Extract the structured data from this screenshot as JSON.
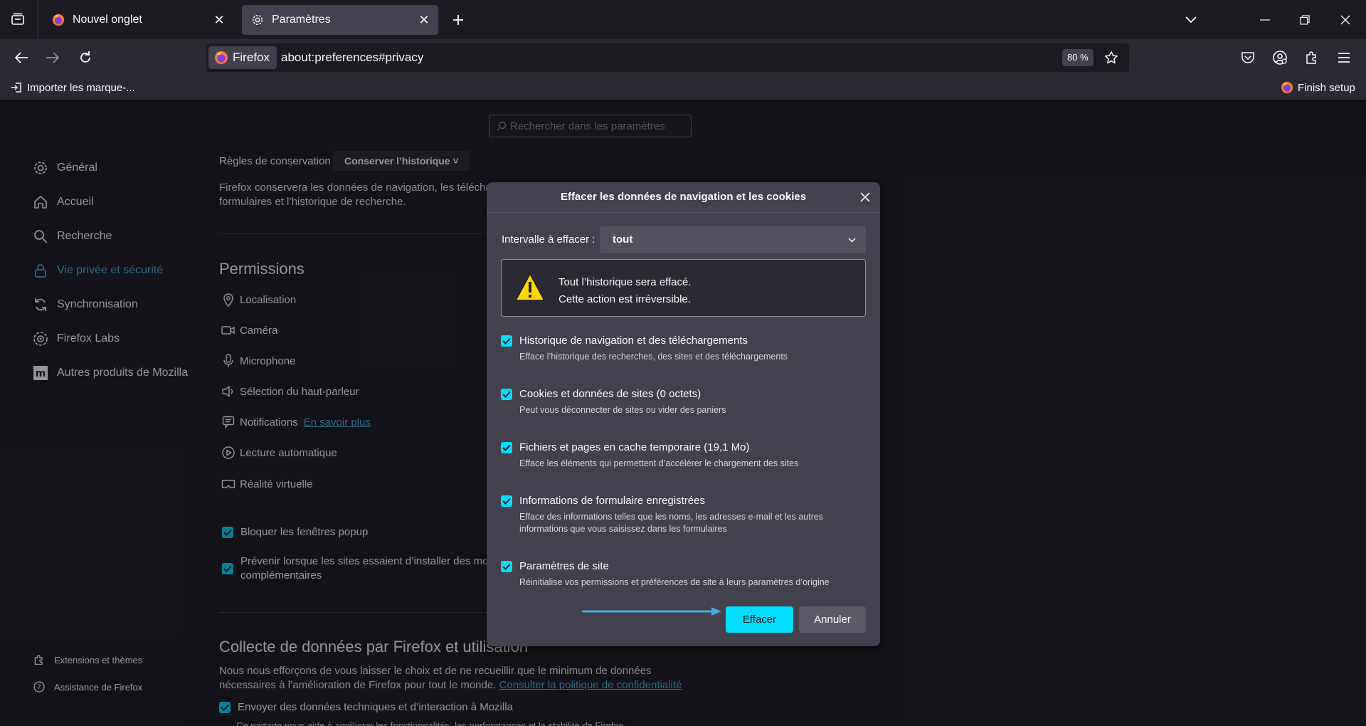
{
  "tabs": [
    {
      "title": "Nouvel onglet",
      "icon": "firefox-icon"
    },
    {
      "title": "Paramètres",
      "icon": "gear-icon",
      "active": true
    }
  ],
  "urlbar": {
    "identity_label": "Firefox",
    "url": "about:preferences#privacy",
    "zoom": "80 %"
  },
  "bookmarks": {
    "import_label": "Importer les marque-...",
    "finish_setup_label": "Finish setup"
  },
  "settings": {
    "search_placeholder": "Rechercher dans les paramètres",
    "sidebar": [
      {
        "label": "Général",
        "icon": "gear-icon"
      },
      {
        "label": "Accueil",
        "icon": "home-icon"
      },
      {
        "label": "Recherche",
        "icon": "search-icon"
      },
      {
        "label": "Vie privée et sécurité",
        "icon": "lock-icon",
        "active": true
      },
      {
        "label": "Synchronisation",
        "icon": "sync-icon"
      },
      {
        "label": "Firefox Labs",
        "icon": "labs-icon"
      },
      {
        "label": "Autres produits de Mozilla",
        "icon": "mozilla-icon"
      }
    ],
    "sidebar_footer": [
      {
        "label": "Extensions et thèmes",
        "icon": "puzzle-icon"
      },
      {
        "label": "Assistance de Firefox",
        "icon": "help-icon"
      }
    ],
    "retention_label": "Règles de conservation",
    "retention_value": "Conserver l’historique",
    "retention_desc_1": "Firefox conservera les données de navigation, les télécha",
    "retention_desc_2": "formulaires et l’historique de recherche.",
    "permissions_heading": "Permissions",
    "permissions": [
      {
        "label": "Localisation",
        "icon": "location-icon"
      },
      {
        "label": "Caméra",
        "icon": "camera-icon"
      },
      {
        "label": "Microphone",
        "icon": "microphone-icon"
      },
      {
        "label": "Sélection du haut-parleur",
        "icon": "speaker-icon"
      },
      {
        "label": "Notifications",
        "icon": "notification-icon",
        "link": "En savoir plus"
      },
      {
        "label": "Lecture automatique",
        "icon": "autoplay-icon"
      },
      {
        "label": "Réalité virtuelle",
        "icon": "vr-icon"
      }
    ],
    "block_popups": "Bloquer les fenêtres popup",
    "warn_addons_1": "Prévenir lorsque les sites essaient d’installer des mod",
    "warn_addons_2": "complémentaires",
    "data_heading": "Collecte de données par Firefox et utilisation",
    "data_desc_1": "Nous nous efforçons de vous laisser le choix et de ne recueillir que le minimum de données",
    "data_desc_2": "nécessaires à l’amélioration de Firefox pour tout le monde.",
    "data_link": "Consulter la politique de confidentialité",
    "send_tech": "Envoyer des données techniques et d’interaction à Mozilla",
    "send_tech_desc": "Ce partage nous aide à améliorer les fonctionnalités, les performances et la stabilité de Firefox"
  },
  "dialog": {
    "title": "Effacer les données de navigation et les cookies",
    "range_label": "Intervalle à effacer :",
    "range_value": "tout",
    "warning_line1": "Tout l’historique sera effacé.",
    "warning_line2": "Cette action est irréversible.",
    "options": [
      {
        "label": "Historique de navigation et des téléchargements",
        "desc": "Efface l’historique des recherches, des sites et des téléchargements",
        "checked": true
      },
      {
        "label": "Cookies et données de sites (0 octets)",
        "desc": "Peut vous déconnecter de sites ou vider des paniers",
        "checked": true
      },
      {
        "label": "Fichiers et pages en cache temporaire (19,1 Mo)",
        "desc": "Efface les éléments qui permettent d’accélérer le chargement des sites",
        "checked": true
      },
      {
        "label": "Informations de formulaire enregistrées",
        "desc": "Efface des informations telles que les noms, les adresses e-mail et les autres informations que vous saisissez dans les formulaires",
        "checked": true
      },
      {
        "label": "Paramètres de site",
        "desc": "Réinitialise vos permissions et préférences de site à leurs paramètres d’origine",
        "checked": true
      }
    ],
    "confirm_label": "Effacer",
    "cancel_label": "Annuler"
  },
  "colors": {
    "accent": "#00ddff",
    "link": "#49b5de",
    "dialog_bg": "#42414d",
    "page_bg": "#1c1b22"
  }
}
